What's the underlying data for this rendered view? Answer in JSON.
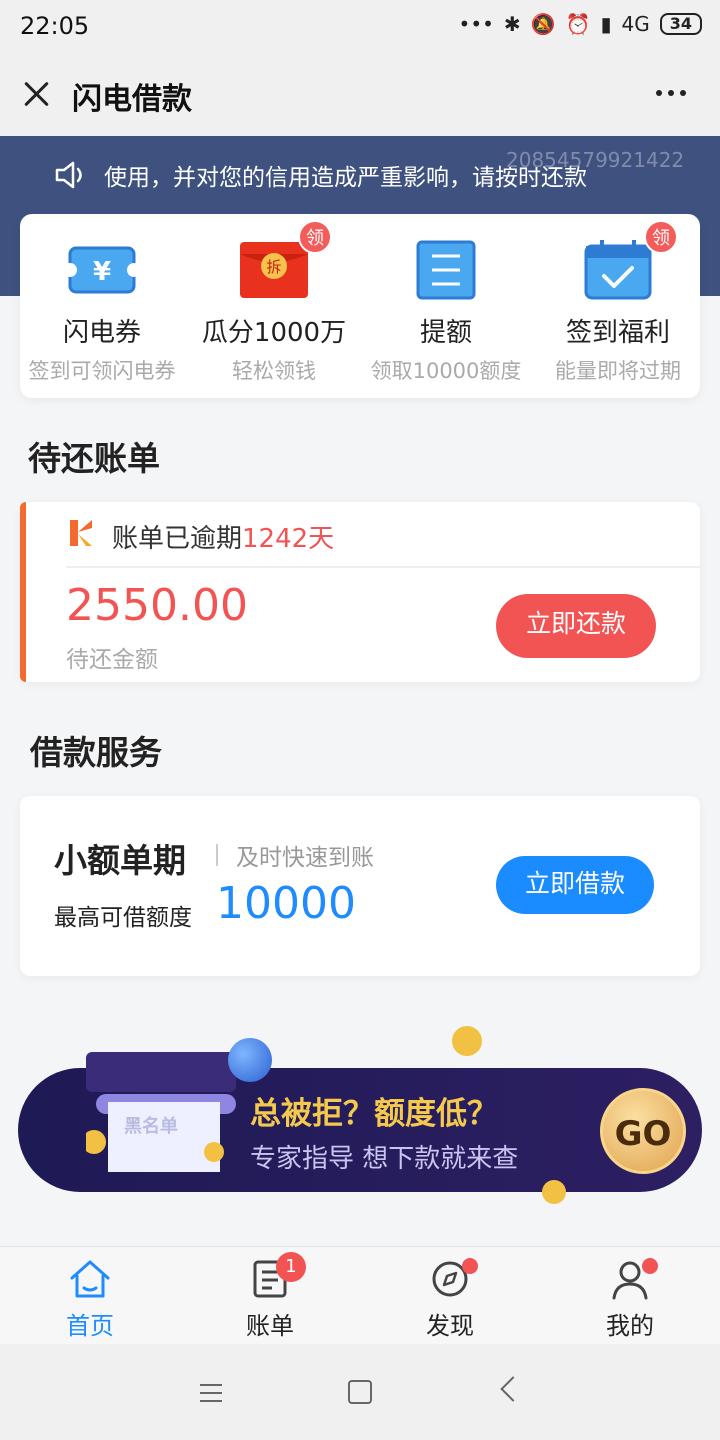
{
  "status_bar": {
    "time": "22:05",
    "network": "4G",
    "battery": "34",
    "icons": [
      "dots-icon",
      "bluetooth-icon",
      "mute-icon",
      "alarm-icon",
      "signal-icon"
    ]
  },
  "header": {
    "title": "闪电借款",
    "close_icon": "close-icon",
    "more_icon": "more-icon"
  },
  "notice": {
    "text": "使用，并对您的信用造成严重影响，请按时还款",
    "serial": "20854579921422",
    "icon": "speaker-icon"
  },
  "features": [
    {
      "title": "闪电券",
      "subtitle": "签到可领闪电券",
      "icon": "coupon-icon",
      "badge": ""
    },
    {
      "title": "瓜分1000万",
      "subtitle": "轻松领钱",
      "icon": "red-envelope-icon",
      "badge": "领",
      "envelope_text": "拆"
    },
    {
      "title": "提额",
      "subtitle": "领取10000额度",
      "icon": "document-icon",
      "badge": ""
    },
    {
      "title": "签到福利",
      "subtitle": "能量即将过期",
      "icon": "calendar-check-icon",
      "badge": "领"
    }
  ],
  "pending_bills": {
    "heading": "待还账单",
    "status_prefix": "账单已逾期",
    "overdue_days": "1242天",
    "amount": "2550.00",
    "amount_label": "待还金额",
    "button": "立即还款"
  },
  "loan_service": {
    "heading": "借款服务",
    "product": "小额单期",
    "tagline": "及时快速到账",
    "limit_label": "最高可借额度",
    "limit": "10000",
    "button": "立即借款"
  },
  "promo": {
    "badge": "黑名单",
    "headline": "总被拒？额度低？",
    "sub": "专家指导 想下款就来查",
    "go": "GO"
  },
  "bottom_nav": [
    {
      "label": "首页",
      "icon": "home-icon",
      "active": true,
      "badge": ""
    },
    {
      "label": "账单",
      "icon": "bill-icon",
      "active": false,
      "badge": "1"
    },
    {
      "label": "发现",
      "icon": "compass-icon",
      "active": false,
      "badge": "dot"
    },
    {
      "label": "我的",
      "icon": "user-icon",
      "active": false,
      "badge": "dot"
    }
  ],
  "colors": {
    "accent_red": "#f25454",
    "accent_blue": "#1e8cff",
    "banner": "#3f527f",
    "promo_gold": "#f5c94b"
  }
}
